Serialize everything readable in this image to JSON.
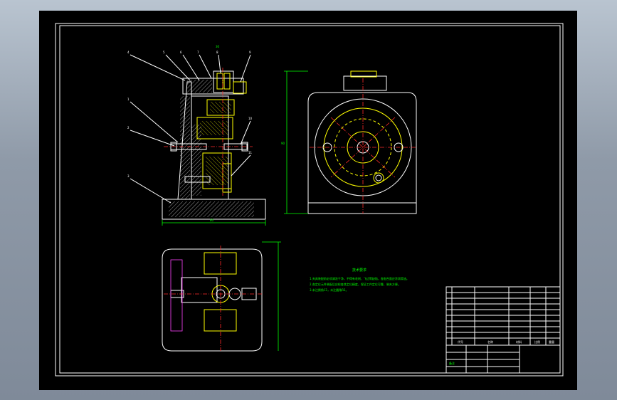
{
  "drawing": {
    "tech_requirements_title": "技术要求",
    "tech_requirements_lines": [
      "1.夹具装配前必须清洗干净，不得有毛刺、飞边等缺陷，各配合面应涂润滑油。",
      "2.各定位元件装配后应检查其定位精度，保证工件定位可靠、装夹方便。",
      "3.未注倒角C1，未注圆角R2。"
    ],
    "title_block": {
      "code_label": "代号",
      "name_label": "名称",
      "material_label": "材料",
      "scale_label": "比例",
      "weight_label": "重量",
      "remark_label": "备注"
    },
    "part_numbers": [
      "1",
      "2",
      "3",
      "4",
      "5",
      "6",
      "7",
      "8",
      "9",
      "10",
      "11"
    ],
    "dimension_width": "80",
    "dimension_height": "90",
    "dimension_top": "30"
  },
  "colors": {
    "background": "#000000",
    "outline": "#ffffff",
    "part": "#ffff00",
    "centerline": "#ff2a2a",
    "dimension": "#00ff00",
    "frame_border": "#ffffff"
  }
}
